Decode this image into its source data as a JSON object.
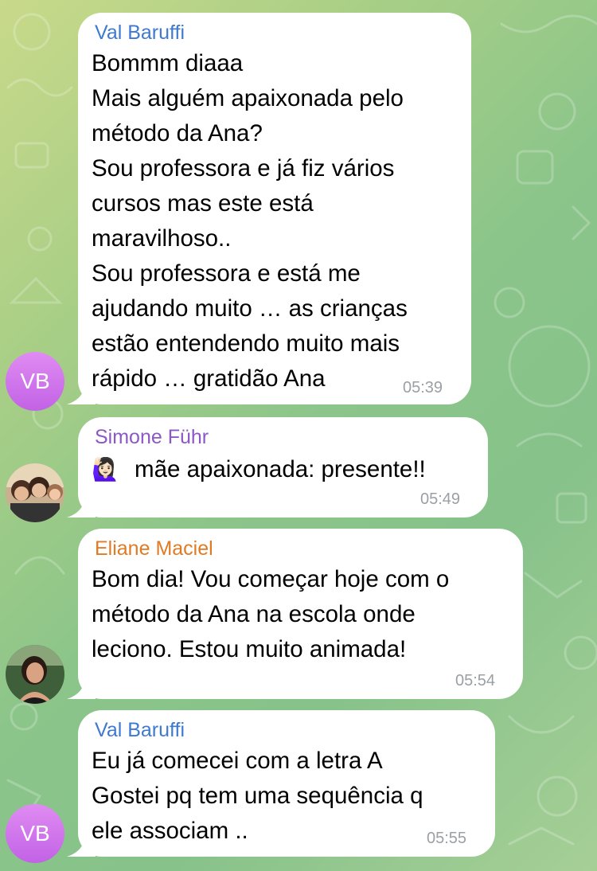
{
  "colors": {
    "bubble": "#ffffff",
    "sender_blue": "#3e7ad0",
    "sender_purple": "#8b58c5",
    "sender_orange": "#e07b25",
    "timestamp": "#9aa0a6",
    "avatar_vb": "#d47af0"
  },
  "messages": [
    {
      "sender": "Val Baruffi",
      "lines": [
        "Bommm diaaa",
        "Mais alguém apaixonada pelo",
        "método da Ana?",
        "Sou professora e já fiz vários",
        "cursos mas este está",
        "maravilhoso..",
        "Sou professora e está me",
        "ajudando muito … as crianças",
        "estão entendendo muito mais",
        "rápido … gratidão Ana"
      ],
      "time": "05:39",
      "avatar_initials": "VB"
    },
    {
      "sender": "Simone Führ",
      "emoji": "🙋🏻‍♀️",
      "lines": [
        "mãe apaixonada: presente!!"
      ],
      "time": "05:49",
      "avatar": "photo-avatar"
    },
    {
      "sender": "Eliane Maciel",
      "lines": [
        "Bom dia! Vou começar hoje com o",
        "método da Ana na escola onde",
        "leciono. Estou muito animada!"
      ],
      "time": "05:54",
      "avatar": "photo-avatar"
    },
    {
      "sender": "Val Baruffi",
      "lines": [
        "Eu já comecei com a letra A",
        "Gostei pq tem uma sequência q",
        "ele associam .."
      ],
      "time": "05:55",
      "avatar_initials": "VB"
    }
  ]
}
